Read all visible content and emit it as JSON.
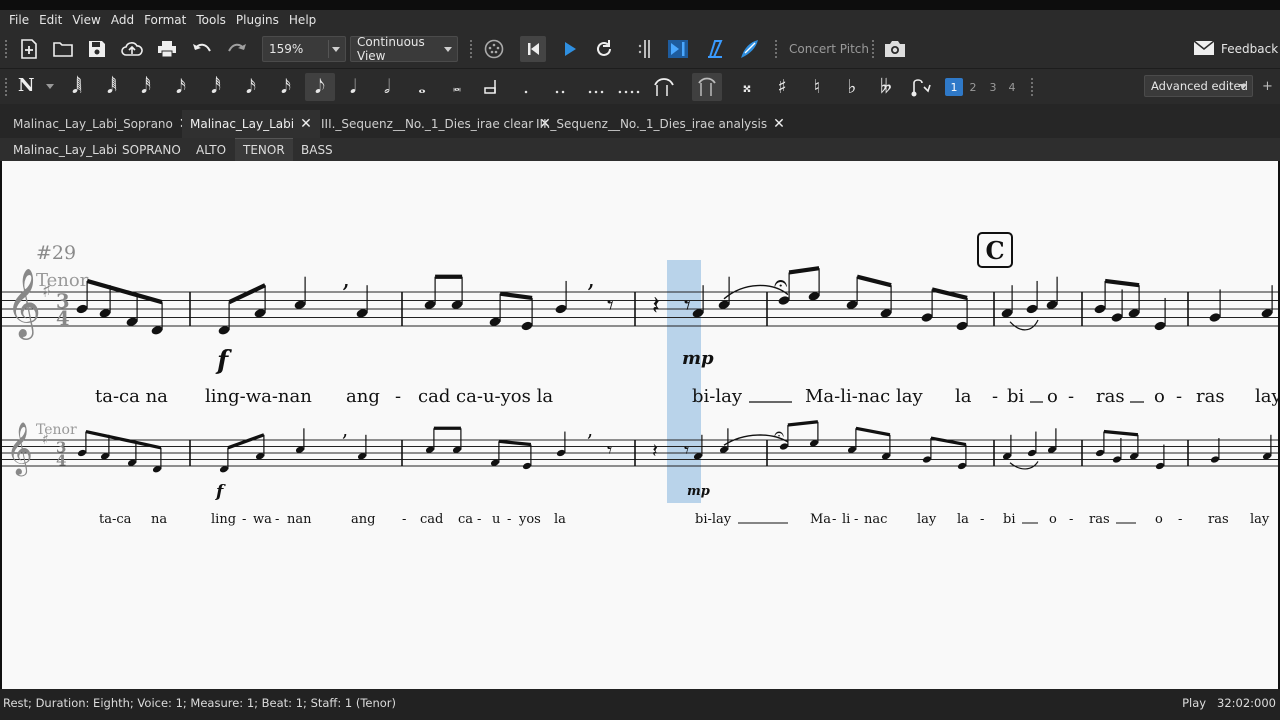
{
  "menu": [
    "File",
    "Edit",
    "View",
    "Add",
    "Format",
    "Tools",
    "Plugins",
    "Help"
  ],
  "toolbar": {
    "zoom_value": "159%",
    "view_mode": "Continuous View",
    "concert_pitch_label": "Concert Pitch",
    "feedback_label": "Feedback",
    "icons": [
      "new-score-icon",
      "open-file-icon",
      "save-icon",
      "cloud-upload-icon",
      "print-icon",
      "undo-icon",
      "redo-icon",
      "midi-input-icon",
      "rewind-icon",
      "play-icon",
      "loop-icon",
      "loop-in-icon",
      "play-repeats-icon",
      "pan-score-icon",
      "metronome-icon",
      "screenshot-icon",
      "mail-icon"
    ]
  },
  "note_input": {
    "mode_glyph": "N",
    "durations": [
      "128th",
      "64th",
      "32nd",
      "16th",
      "eighth",
      "quarter",
      "half",
      "whole",
      "breve",
      "longa",
      "augmentation dot",
      "double dot",
      "triple dot",
      "quadruple dot"
    ],
    "accidentals": [
      "double sharp",
      "sharp",
      "natural",
      "flat",
      "double flat"
    ],
    "voices": [
      "1",
      "2",
      "3",
      "4"
    ],
    "workspace": "Advanced edited",
    "workspace_add": "+"
  },
  "tabs": [
    {
      "label": "Malinac_Lay_Labi_Soprano",
      "active": false
    },
    {
      "label": "Malinac_Lay_Labi",
      "active": true
    },
    {
      "label": "III._Sequenz__No._1_Dies_irae clear",
      "active": false
    },
    {
      "label": "III._Sequenz__No._1_Dies_irae analysis",
      "active": false
    }
  ],
  "parts": [
    {
      "label": "Malinac_Lay_Labi",
      "active": false
    },
    {
      "label": "SOPRANO",
      "active": false
    },
    {
      "label": "ALTO",
      "active": false
    },
    {
      "label": "TENOR",
      "active": true
    },
    {
      "label": "BASS",
      "active": false
    }
  ],
  "score": {
    "measure_number": "#29",
    "staff_name": "Tenor",
    "time_signature": "3/4",
    "rehearsal_mark": "C",
    "dynamics": [
      "f",
      "mp"
    ],
    "lyrics_top": [
      "ta-ca na",
      "ling-wa-nan",
      "ang",
      "-",
      "cad ca-u-yos la",
      "bi-lay",
      "Ma-li-nac lay",
      "la",
      "-",
      "bi",
      "o",
      "-",
      "ras",
      "o",
      "-",
      "ras",
      "lay"
    ],
    "lyrics_bottom": [
      "ta-ca",
      "na",
      "ling",
      "-",
      "wa",
      "-",
      "nan",
      "ang",
      "-",
      "cad",
      "ca",
      "-",
      "u",
      "-",
      "yos",
      "la",
      "bi-lay",
      "Ma",
      "-",
      "li",
      "-",
      "nac",
      "lay",
      "la",
      "-",
      "bi",
      "o",
      "-",
      "ras",
      "o",
      "-",
      "ras",
      "lay"
    ]
  },
  "status": {
    "text": "Rest; Duration: Eighth; Voice: 1;  Measure: 1; Beat: 1; Staff: 1 (Tenor)",
    "mode": "Play",
    "time": "32:02:000"
  },
  "colors": {
    "accent": "#2f79c8",
    "selection": "#b9d3ea"
  }
}
